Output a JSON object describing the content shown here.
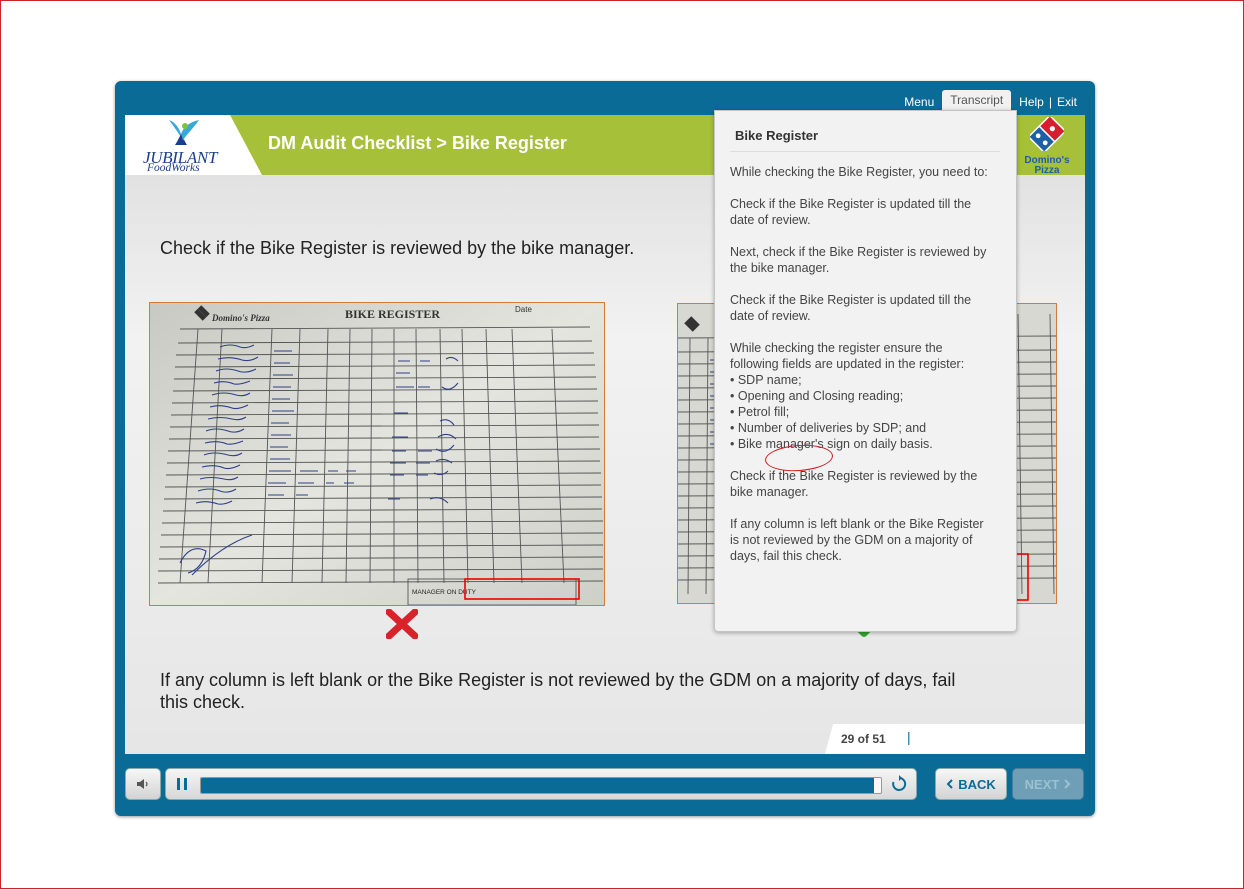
{
  "nav": {
    "menu": "Menu",
    "transcript": "Transcript",
    "help": "Help",
    "exit": "Exit"
  },
  "header": {
    "logo_line1": "JUBILANT",
    "logo_line2": "FoodWorks",
    "title": "DM Audit Checklist > Bike Register",
    "brand_line1": "Domino's",
    "brand_line2": "Pizza"
  },
  "slide": {
    "top_text": "Check if the Bike Register is reviewed by the bike manager.",
    "bottom_text": "If any column is left blank or the Bike Register is not reviewed by the GDM on a majority of days, fail this check.",
    "photo_left": {
      "brand": "Domino's Pizza",
      "heading": "BIKE REGISTER",
      "date_label": "Date",
      "footer_label": "MANAGER ON DUTY"
    }
  },
  "page_counter": "29 of 51",
  "controls": {
    "back_label": "BACK",
    "next_label": "NEXT",
    "progress": 0.99
  },
  "transcript": {
    "title": "Bike Register",
    "p1": "While checking the Bike Register, you need to:",
    "p2": "Check if the Bike Register is updated till the date of review.",
    "p3": "Next, check if the Bike Register is reviewed by the bike manager.",
    "p4": "Check if the Bike Register is updated till the date of review.",
    "p5": "While checking the register ensure the following fields are updated in the register:",
    "bullets": [
      "• SDP name;",
      "• Opening and Closing reading;",
      "• Petrol fill;",
      "• Number of deliveries by SDP; and",
      "• Bike manager's sign on daily basis."
    ],
    "p6": "Check if the Bike Register is reviewed by the bike manager.",
    "p7": "If any column is left blank or the Bike Register is not reviewed by the GDM on a majority of days, fail this check."
  },
  "colors": {
    "player": "#0a6c96",
    "header_green": "#a7c03a",
    "cross": "#d9232a",
    "check": "#2fa62f"
  }
}
